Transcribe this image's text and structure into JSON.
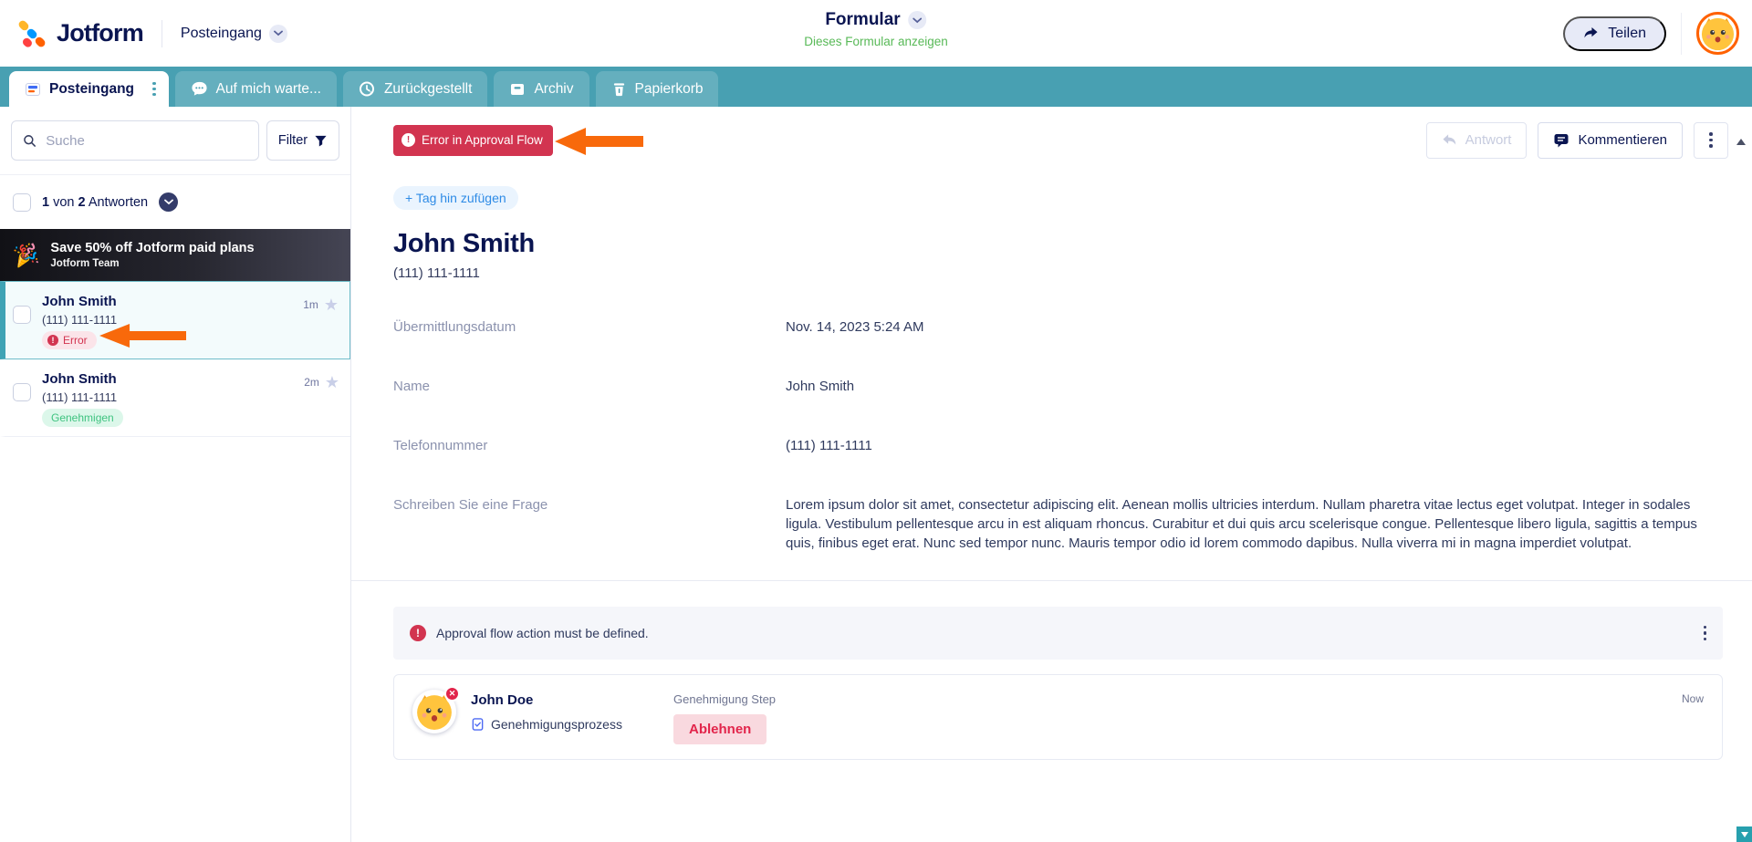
{
  "header": {
    "logo_text": "Jotform",
    "workspace": "Posteingang",
    "form_title": "Formular",
    "form_link": "Dieses Formular anzeigen",
    "share_label": "Teilen"
  },
  "tabs": [
    {
      "label": "Posteingang",
      "active": true
    },
    {
      "label": "Auf mich warte...",
      "active": false
    },
    {
      "label": "Zurückgestellt",
      "active": false
    },
    {
      "label": "Archiv",
      "active": false
    },
    {
      "label": "Papierkorb",
      "active": false
    }
  ],
  "sidebar": {
    "search_placeholder": "Suche",
    "filter_label": "Filter",
    "count": {
      "bold1": "1",
      "mid": " von ",
      "bold2": "2",
      "rest": " Antworten"
    },
    "promo": {
      "emoji": "🎉",
      "title": "Save 50% off Jotform paid plans",
      "subtitle": "Jotform Team"
    },
    "items": [
      {
        "name": "John Smith",
        "phone": "(111) 111-1111",
        "tag": "Error",
        "tag_icon": "!",
        "time": "1m",
        "selected": true
      },
      {
        "name": "John Smith",
        "phone": "(111) 111-1111",
        "tag": "Genehmigen",
        "time": "2m",
        "selected": false
      }
    ]
  },
  "toolbar": {
    "error_badge_label": "Error in Approval Flow",
    "error_badge_icon": "!",
    "reply_label": "Antwort",
    "comment_label": "Kommentieren"
  },
  "submission": {
    "add_tag_label": "+ Tag hin zufügen",
    "title": "John Smith",
    "subtitle": "(111) 111-1111",
    "fields": [
      {
        "label": "Übermittlungsdatum",
        "value": "Nov. 14, 2023 5:24 AM"
      },
      {
        "label": "Name",
        "value": "John Smith"
      },
      {
        "label": "Telefonnummer",
        "value": "(111) 111-1111"
      },
      {
        "label": "Schreiben Sie eine Frage",
        "value": "Lorem ipsum dolor sit amet, consectetur adipiscing elit. Aenean mollis ultricies interdum. Nullam pharetra vitae lectus eget volutpat. Integer in sodales ligula. Vestibulum pellentesque arcu in est aliquam rhoncus. Curabitur et dui quis arcu scelerisque congue. Pellentesque libero ligula, sagittis a tempus quis, finibus eget erat. Nunc sed tempor nunc. Mauris tempor odio id lorem commodo dapibus. Nulla viverra mi in magna imperdiet volutpat."
      }
    ]
  },
  "approval": {
    "error_message": "Approval flow action must be defined.",
    "error_icon": "!",
    "card": {
      "name": "John Doe",
      "process": "Genehmigungsprozess",
      "step_label": "Genehmigung Step",
      "action_label": "Ablehnen",
      "time": "Now"
    }
  },
  "colors": {
    "brand_navy": "#0A1551",
    "tab_teal": "#48A0B2",
    "error_red": "#D23450",
    "reject_red": "#E2254B",
    "approve_green": "#3FC380",
    "link_green": "#58B957",
    "arrow_orange": "#F8690B",
    "brand_orange": "#FF6100",
    "brand_blue": "#0099FF",
    "brand_yellow": "#FFB629"
  }
}
